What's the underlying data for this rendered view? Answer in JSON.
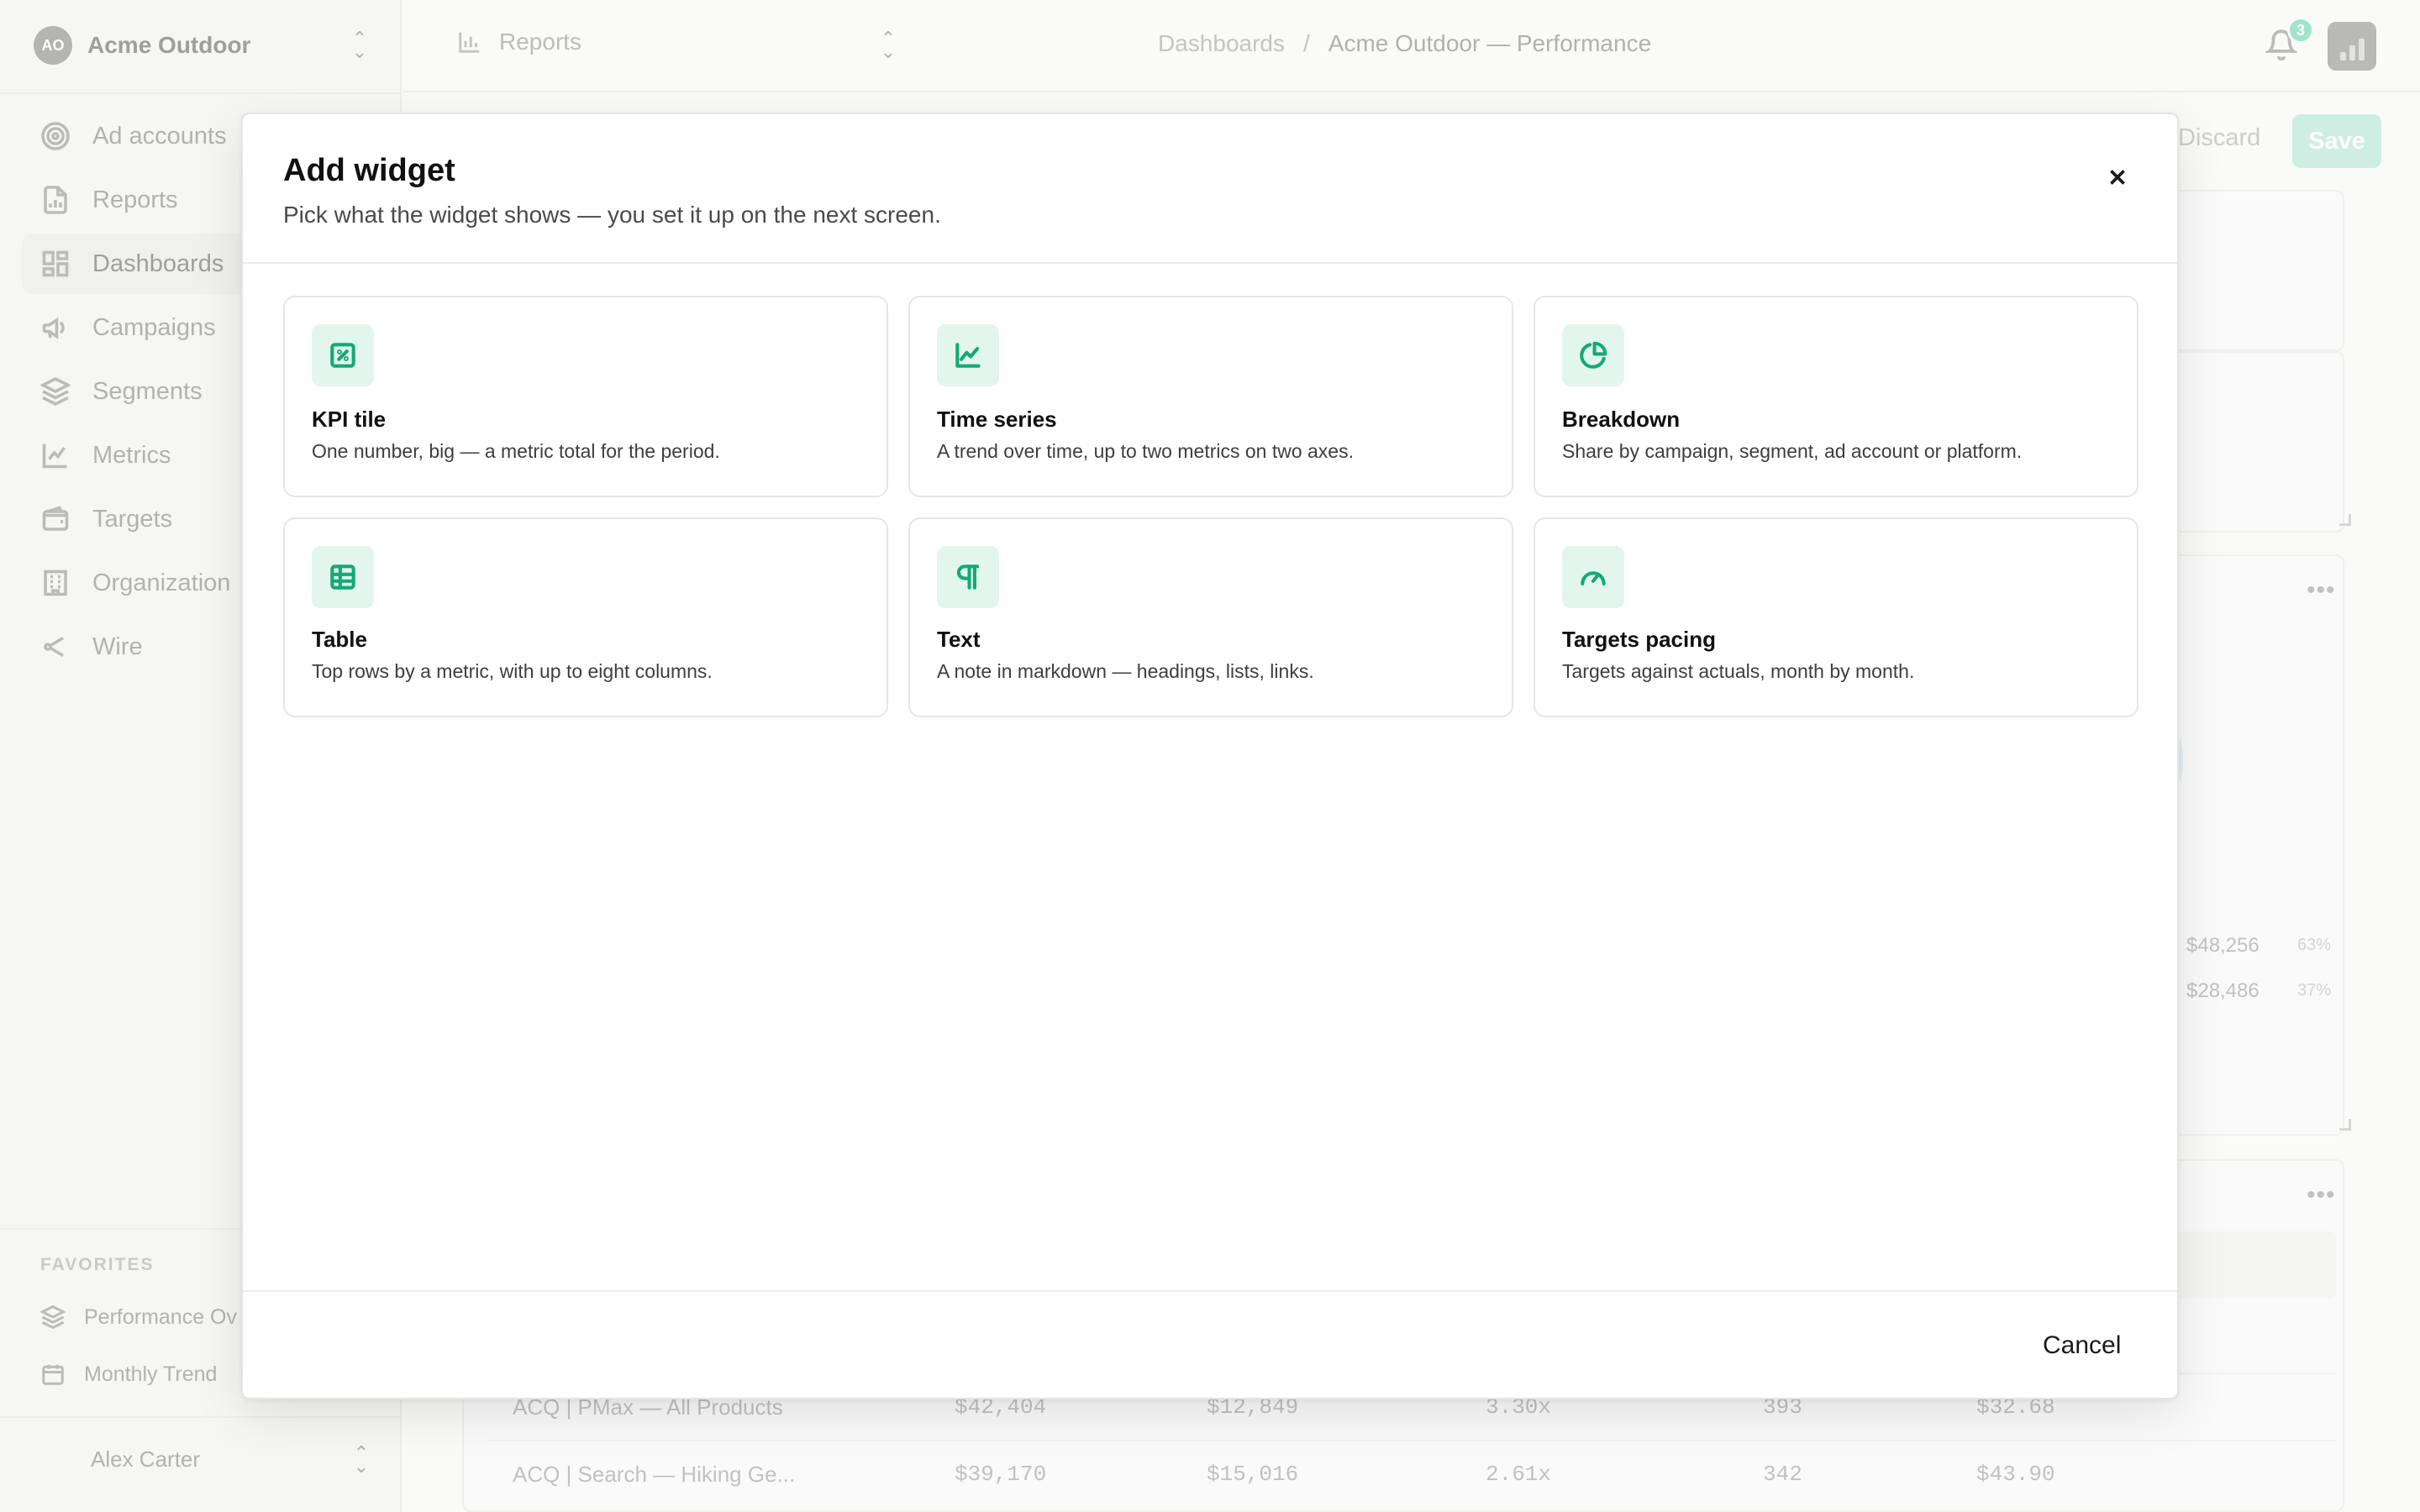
{
  "org": {
    "initials": "AO",
    "name": "Acme Outdoor"
  },
  "sidebar": {
    "items": [
      {
        "label": "Ad accounts",
        "icon": "target-icon"
      },
      {
        "label": "Reports",
        "icon": "document-chart-icon"
      },
      {
        "label": "Dashboards",
        "icon": "dashboard-grid-icon",
        "active": true
      },
      {
        "label": "Campaigns",
        "icon": "megaphone-icon"
      },
      {
        "label": "Segments",
        "icon": "layers-icon"
      },
      {
        "label": "Metrics",
        "icon": "line-chart-icon"
      },
      {
        "label": "Targets",
        "icon": "wallet-icon"
      },
      {
        "label": "Organization",
        "icon": "building-icon"
      },
      {
        "label": "Wire",
        "icon": "share-node-icon"
      }
    ],
    "favorites_title": "FAVORITES",
    "favorites": [
      {
        "label": "Performance Ov",
        "icon": "layers-icon"
      },
      {
        "label": "Monthly Trend",
        "icon": "calendar-icon"
      }
    ],
    "user": {
      "name": "Alex Carter"
    }
  },
  "topbar": {
    "report_picker": "Reports",
    "breadcrumb": {
      "parent": "Dashboards",
      "separator": "/",
      "current": "Acme Outdoor — Performance"
    },
    "notification_count": "3"
  },
  "toolbar": {
    "discard_label": "Discard",
    "save_label": "Save"
  },
  "background": {
    "legend": [
      {
        "value": "$48,256",
        "pct": "63%"
      },
      {
        "value": "$28,486",
        "pct": "37%"
      }
    ],
    "table_rows": [
      {
        "name": "ACQ | PMax — All Products",
        "c1": "$42,404",
        "c2": "$12,849",
        "c3": "3.30x",
        "c4": "393",
        "c5": "$32.68"
      },
      {
        "name": "ACQ | Search — Hiking Ge...",
        "c1": "$39,170",
        "c2": "$15,016",
        "c3": "2.61x",
        "c4": "342",
        "c5": "$43.90"
      }
    ]
  },
  "modal": {
    "title": "Add widget",
    "subtitle": "Pick what the widget shows — you set it up on the next screen.",
    "cancel_label": "Cancel",
    "accent_color": "#15a878",
    "icon_bg_color": "#e2f6ee",
    "widgets": [
      {
        "title": "KPI tile",
        "desc": "One number, big — a metric total for the period.",
        "icon": "kpi-percent-icon"
      },
      {
        "title": "Time series",
        "desc": "A trend over time, up to two metrics on two axes.",
        "icon": "line-chart-icon"
      },
      {
        "title": "Breakdown",
        "desc": "Share by campaign, segment, ad account or platform.",
        "icon": "pie-chart-icon"
      },
      {
        "title": "Table",
        "desc": "Top rows by a metric, with up to eight columns.",
        "icon": "table-icon"
      },
      {
        "title": "Text",
        "desc": "A note in markdown — headings, lists, links.",
        "icon": "pilcrow-icon"
      },
      {
        "title": "Targets pacing",
        "desc": "Targets against actuals, month by month.",
        "icon": "gauge-icon"
      }
    ]
  }
}
